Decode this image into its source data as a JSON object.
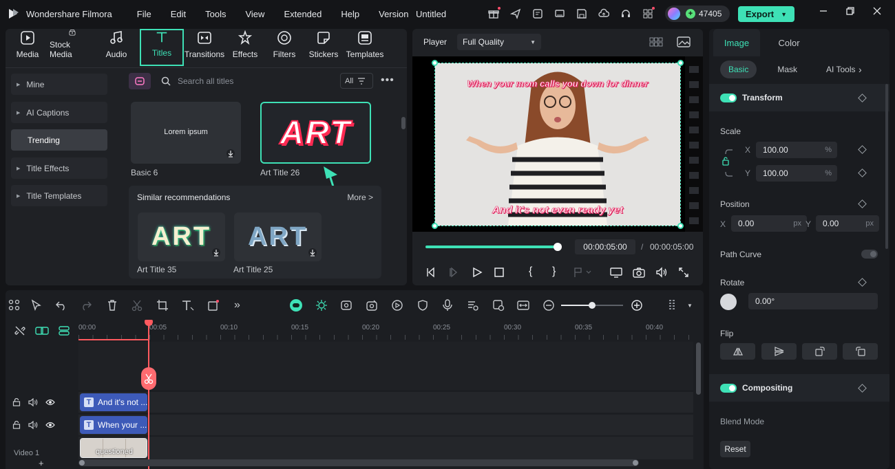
{
  "app": {
    "name": "Wondershare Filmora",
    "doc_title": "Untitled",
    "credits": "47405",
    "export_label": "Export"
  },
  "menu": [
    "File",
    "Edit",
    "Tools",
    "View",
    "Extended",
    "Help",
    "Version"
  ],
  "media_tabs": [
    {
      "label": "Media",
      "icon": "media-icon"
    },
    {
      "label": "Stock Media",
      "icon": "stock-media-icon"
    },
    {
      "label": "Audio",
      "icon": "audio-icon"
    },
    {
      "label": "Titles",
      "icon": "titles-icon"
    },
    {
      "label": "Transitions",
      "icon": "transitions-icon"
    },
    {
      "label": "Effects",
      "icon": "effects-icon"
    },
    {
      "label": "Filters",
      "icon": "filters-icon"
    },
    {
      "label": "Stickers",
      "icon": "stickers-icon"
    },
    {
      "label": "Templates",
      "icon": "templates-icon"
    }
  ],
  "sidebar": [
    "Mine",
    "AI Captions",
    "Trending",
    "Title Effects",
    "Title Templates"
  ],
  "browser": {
    "search_placeholder": "Search all titles",
    "filter_label": "All",
    "cards": [
      {
        "label": "Basic 6",
        "preview_text": "Lorem ipsum"
      },
      {
        "label": "Art Title 26",
        "preview_text": "ART"
      }
    ],
    "similar": {
      "title": "Similar recommendations",
      "more": "More >",
      "items": [
        {
          "label": "Art Title 35",
          "preview_text": "ART"
        },
        {
          "label": "Art Title 25",
          "preview_text": "ART"
        }
      ]
    }
  },
  "player": {
    "label": "Player",
    "quality": "Full Quality",
    "caption_top": "When your mom calls you down for dinner",
    "caption_bottom": "And it's not even ready yet",
    "current_time": "00:00:05:00",
    "separator": "/",
    "total_time": "00:00:05:00",
    "progress": 1.0
  },
  "timeline": {
    "ticks": [
      "00:00",
      "00:05",
      "00:10",
      "00:15",
      "00:20",
      "00:25",
      "00:30",
      "00:35",
      "00:40"
    ],
    "clips": {
      "text1": "And it's not ...",
      "text2": "When your ...",
      "video": "questioned"
    },
    "video_track_label": "Video 1",
    "add_track": "+"
  },
  "right_panel": {
    "tabs": [
      "Image",
      "Color"
    ],
    "subtabs": [
      "Basic",
      "Mask",
      "AI Tools"
    ],
    "transform": {
      "title": "Transform",
      "scale_label": "Scale",
      "scale_x_label": "X",
      "scale_y_label": "Y",
      "scale_x": "100.00",
      "scale_y": "100.00",
      "percent": "%",
      "position_label": "Position",
      "pos_x_label": "X",
      "pos_y_label": "Y",
      "pos_x": "0.00",
      "pos_y": "0.00",
      "px": "px",
      "path_curve_label": "Path Curve",
      "rotate_label": "Rotate",
      "rotate_value": "0.00°",
      "flip_label": "Flip"
    },
    "compositing": {
      "title": "Compositing",
      "blend_mode_label": "Blend Mode"
    },
    "reset_label": "Reset"
  },
  "colors": {
    "accent": "#3ee1b6",
    "playhead": "#ff5a5f",
    "title_clip": "#3d5ab8"
  }
}
